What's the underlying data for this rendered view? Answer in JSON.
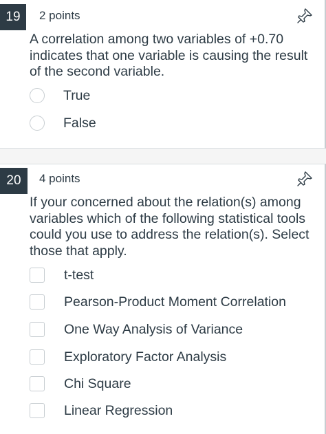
{
  "questions": [
    {
      "number": "19",
      "points": "2 points",
      "text": "A correlation among two variables of +0.70 indicates that one variable is causing the result of the second variable.",
      "answer_type": "radio",
      "answers": [
        "True",
        "False"
      ],
      "pin_icon": "pin-icon"
    },
    {
      "number": "20",
      "points": "4 points",
      "text": "If your concerned about the relation(s) among variables which of the following statistical tools could you use to address the relation(s). Select those that apply.",
      "answer_type": "checkbox",
      "answers": [
        "t-test",
        "Pearson-Product Moment Correlation",
        "One Way Analysis of Variance",
        "Exploratory Factor Analysis",
        "Chi Square",
        "Linear Regression"
      ],
      "pin_icon": "pin-icon"
    }
  ],
  "colors": {
    "badge_bg": "#2d3b45",
    "text": "#2d3b45",
    "control_border": "#c7cdd1",
    "gap_bg": "#f5f5f5"
  }
}
